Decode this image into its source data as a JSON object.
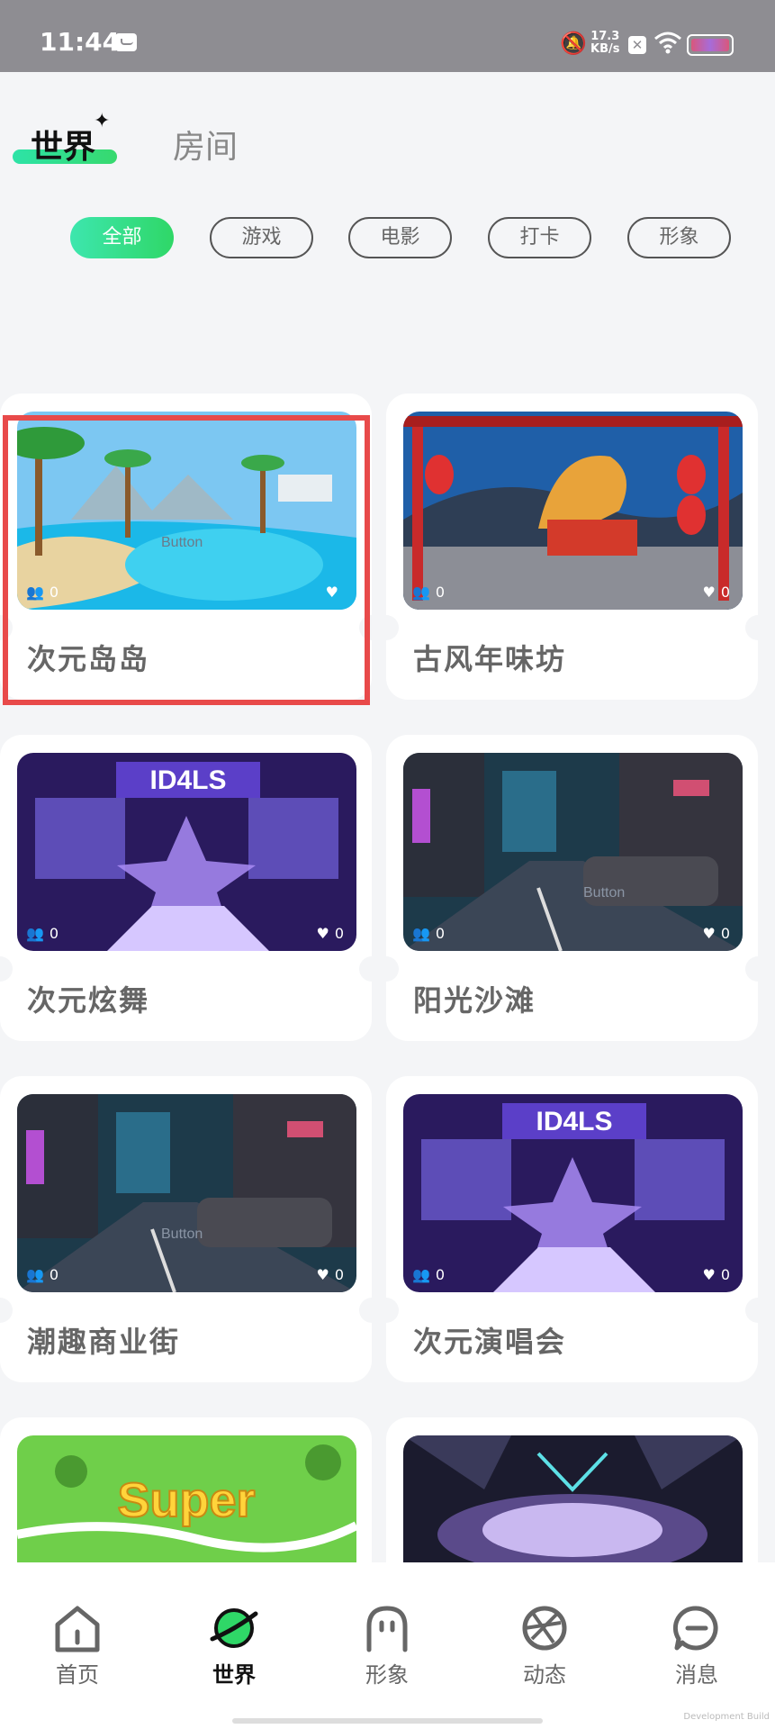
{
  "status_bar": {
    "time": "11:44",
    "net_speed_value": "17.3",
    "net_speed_unit": "KB/s"
  },
  "top_tabs": [
    {
      "label": "世界",
      "active": true
    },
    {
      "label": "房间",
      "active": false
    }
  ],
  "categories": [
    {
      "label": "全部",
      "active": true
    },
    {
      "label": "游戏",
      "active": false
    },
    {
      "label": "电影",
      "active": false
    },
    {
      "label": "打卡",
      "active": false
    },
    {
      "label": "形象",
      "active": false
    }
  ],
  "cards": [
    {
      "title": "次元岛岛",
      "visitors": "0",
      "likes": "",
      "overlay": "Button"
    },
    {
      "title": "古风年味坊",
      "visitors": "0",
      "likes": "0",
      "overlay": ""
    },
    {
      "title": "次元炫舞",
      "visitors": "0",
      "likes": "0",
      "overlay": ""
    },
    {
      "title": "阳光沙滩",
      "visitors": "0",
      "likes": "0",
      "overlay": "Button"
    },
    {
      "title": "潮趣商业街",
      "visitors": "0",
      "likes": "0",
      "overlay": "Button"
    },
    {
      "title": "次元演唱会",
      "visitors": "0",
      "likes": "0",
      "overlay": ""
    },
    {
      "title": "",
      "visitors": "",
      "likes": "",
      "overlay": ""
    },
    {
      "title": "",
      "visitors": "",
      "likes": "",
      "overlay": ""
    }
  ],
  "bottom_nav": [
    {
      "label": "首页",
      "active": false
    },
    {
      "label": "世界",
      "active": true
    },
    {
      "label": "形象",
      "active": false
    },
    {
      "label": "动态",
      "active": false
    },
    {
      "label": "消息",
      "active": false
    }
  ],
  "build_note": "Development Build",
  "colors": {
    "accent_green": "#2fd767",
    "highlight_red": "#e84a4a",
    "status_bar": "#8e8d92"
  }
}
